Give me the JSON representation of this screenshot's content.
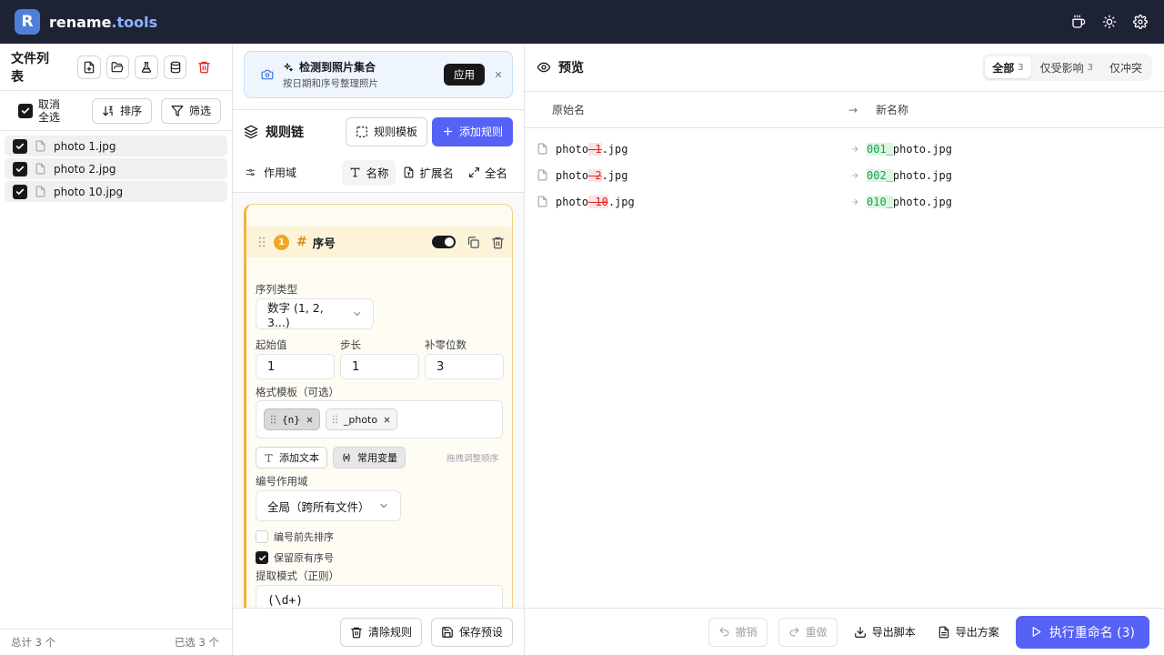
{
  "app": {
    "logo_letter": "R",
    "brand_name": "rename",
    "brand_tld": ".tools"
  },
  "top_icons": [
    "coffee-icon",
    "sun-icon",
    "gear-icon"
  ],
  "file_panel": {
    "title": "文件列表",
    "deselect_all_line1": "取消",
    "deselect_all_line2": "全选",
    "sort_label": "排序",
    "filter_label": "筛选",
    "files": [
      {
        "name": "photo 1.jpg",
        "checked": true
      },
      {
        "name": "photo 2.jpg",
        "checked": true
      },
      {
        "name": "photo 10.jpg",
        "checked": true
      }
    ],
    "total": "总计 3 个",
    "selected": "已选 3 个"
  },
  "banner": {
    "title": "检测到照片集合",
    "subtitle": "按日期和序号整理照片",
    "apply_label": "应用",
    "close": "×"
  },
  "rule_chain": {
    "title": "规则链",
    "template_label": "规则模板",
    "add_label": "添加规则",
    "scope_label": "作用域",
    "scope_options": [
      "名称",
      "扩展名",
      "全名"
    ],
    "scope_selected": "名称"
  },
  "rule": {
    "index": "1",
    "title": "序号",
    "enabled": true,
    "seq_type_label": "序列类型",
    "seq_type_value": "数字 (1, 2, 3...)",
    "start_label": "起始值",
    "start_value": "1",
    "step_label": "步长",
    "step_value": "1",
    "pad_label": "补零位数",
    "pad_value": "3",
    "format_label": "格式模板（可选）",
    "tokens": [
      "{n}",
      "_photo"
    ],
    "add_text_label": "添加文本",
    "common_vars_label": "常用变量",
    "drag_hint": "拖拽调整顺序",
    "numbering_scope_label": "编号作用域",
    "numbering_scope_value": "全局（跨所有文件）",
    "sort_first_label": "编号前先排序",
    "sort_first_checked": false,
    "keep_original_label": "保留原有序号",
    "keep_original_checked": true,
    "extract_label": "提取模式（正则）",
    "extract_value": "(\\d+)"
  },
  "mid_footer": {
    "clear_label": "清除规则",
    "save_label": "保存预设"
  },
  "preview": {
    "title": "预览",
    "filters": [
      {
        "label": "全部",
        "count": "3",
        "active": true
      },
      {
        "label": "仅受影响",
        "count": "3",
        "active": false
      },
      {
        "label": "仅冲突",
        "count": "",
        "active": false
      }
    ],
    "col_original": "原始名",
    "col_arrow": "→",
    "col_new": "新名称",
    "rows": [
      {
        "orig_prefix": "photo",
        "orig_removed": "-1",
        "orig_suffix": ".jpg",
        "new_added": "001_",
        "new_rest": "photo.jpg"
      },
      {
        "orig_prefix": "photo",
        "orig_removed": "-2",
        "orig_suffix": ".jpg",
        "new_added": "002_",
        "new_rest": "photo.jpg"
      },
      {
        "orig_prefix": "photo",
        "orig_removed": "-10",
        "orig_suffix": ".jpg",
        "new_added": "010_",
        "new_rest": "photo.jpg"
      }
    ]
  },
  "right_footer": {
    "undo_label": "撤销",
    "redo_label": "重做",
    "export_script_label": "导出脚本",
    "export_plan_label": "导出方案",
    "run_label": "执行重命名 (3)"
  },
  "colors": {
    "topbar": "#1e2235",
    "primary": "#5661f5",
    "rule_accent": "#f2a61f",
    "removed": "#dc2626",
    "added": "#16a34a"
  }
}
